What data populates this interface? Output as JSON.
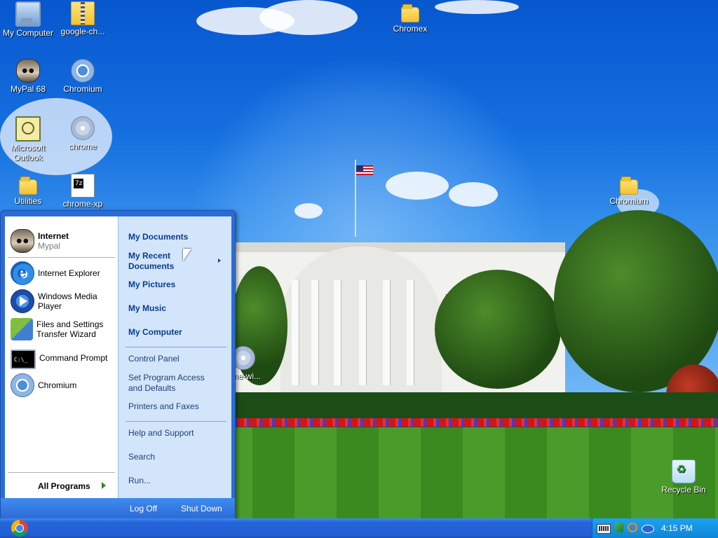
{
  "desktop": {
    "icons": [
      {
        "label": "My Computer",
        "icon": "my-computer-icon"
      },
      {
        "label": "google-ch...",
        "icon": "zip-folder-icon"
      },
      {
        "label": "Chromex",
        "icon": "folder-icon"
      },
      {
        "label": "MyPal 68",
        "icon": "mypal-icon"
      },
      {
        "label": "Chromium",
        "icon": "chromium-icon"
      },
      {
        "label": "Microsoft Outlook",
        "icon": "outlook-icon"
      },
      {
        "label": "chrome",
        "icon": "chrome-cd-icon"
      },
      {
        "label": "Utilities",
        "icon": "folder-icon"
      },
      {
        "label": "chrome-xp",
        "icon": "7z-archive-icon"
      },
      {
        "label": "Chromium",
        "icon": "folder-icon"
      },
      {
        "label": "ome-wi...",
        "icon": "cd-installer-icon"
      },
      {
        "label": "Recycle Bin",
        "icon": "recycle-bin-icon"
      }
    ]
  },
  "start_menu": {
    "pinned": {
      "title": "Internet",
      "subtitle": "Mypal"
    },
    "recent_programs": [
      {
        "label": "Internet Explorer",
        "icon": "internet-explorer-icon"
      },
      {
        "label": "Windows Media Player",
        "icon": "windows-media-player-icon"
      },
      {
        "label": "Files and Settings Transfer Wizard",
        "icon": "transfer-wizard-icon"
      },
      {
        "label": "Command Prompt",
        "icon": "command-prompt-icon"
      },
      {
        "label": "Chromium",
        "icon": "chromium-icon"
      }
    ],
    "all_programs": "All Programs",
    "places": [
      {
        "label": "My Documents"
      },
      {
        "label": "My Recent Documents",
        "submenu": true
      },
      {
        "label": "My Pictures"
      },
      {
        "label": "My Music"
      },
      {
        "label": "My Computer"
      }
    ],
    "system": [
      {
        "label": "Control Panel"
      },
      {
        "label": "Set Program Access and Defaults"
      },
      {
        "label": "Printers and Faxes"
      }
    ],
    "support": [
      {
        "label": "Help and Support"
      },
      {
        "label": "Search"
      },
      {
        "label": "Run..."
      }
    ],
    "log_off": "Log Off",
    "shut_down": "Shut Down"
  },
  "taskbar": {
    "start_icon": "chrome-logo-icon",
    "tray_icons": [
      "keyboard-icon",
      "network-icon",
      "search-icon",
      "volume-icon"
    ],
    "clock": "4:15 PM"
  }
}
